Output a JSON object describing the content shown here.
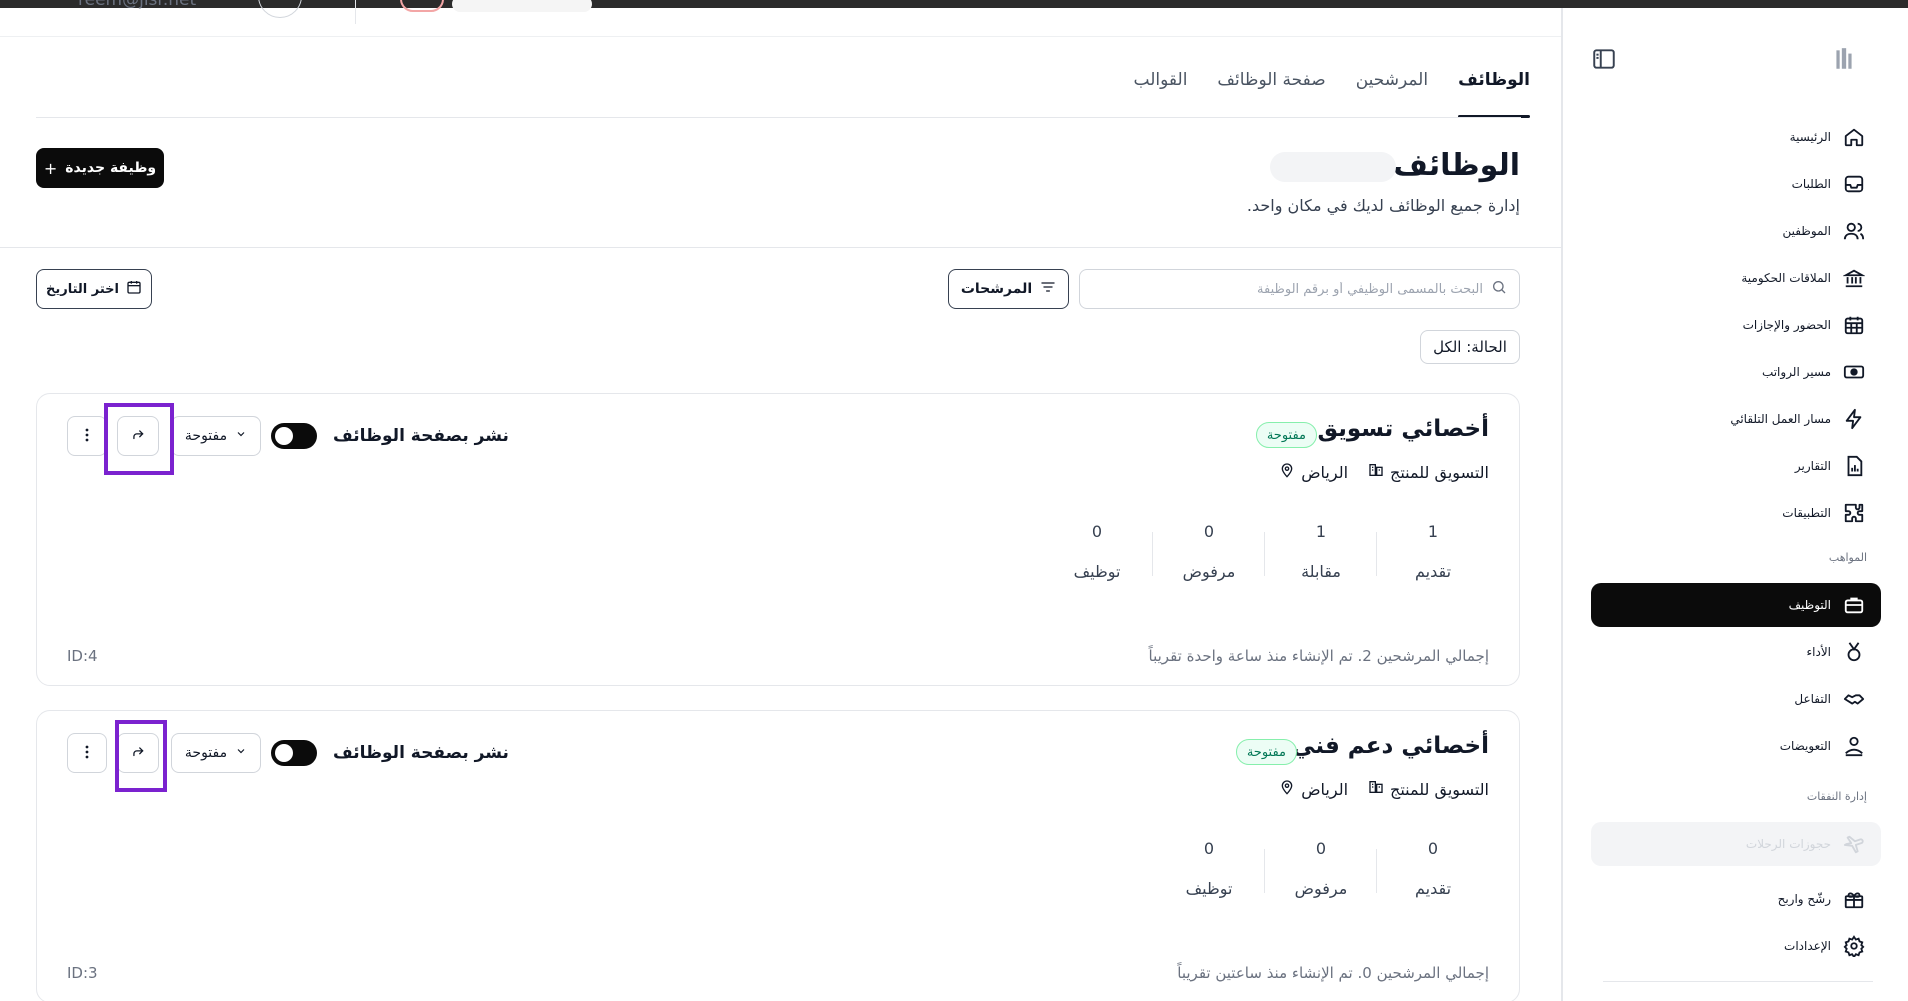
{
  "user": {
    "email": "reem@jisr.net"
  },
  "sidebar": {
    "items": [
      {
        "label": "الرئيسية",
        "icon": "home-icon"
      },
      {
        "label": "الطلبات",
        "icon": "inbox-icon"
      },
      {
        "label": "الموظفين",
        "icon": "users-icon"
      },
      {
        "label": "الملاقات الحكومية",
        "icon": "government-building-icon"
      },
      {
        "label": "الحضور والإجازات",
        "icon": "calendar-icon"
      },
      {
        "label": "مسير الرواتب",
        "icon": "cash-icon"
      },
      {
        "label": "مسار العمل التلقائي",
        "icon": "automation-icon"
      },
      {
        "label": "التقارير",
        "icon": "report-icon"
      },
      {
        "label": "التطبيقات",
        "icon": "puzzle-icon"
      }
    ],
    "section_talent": "المواهب",
    "talent_items": [
      {
        "label": "التوظيف",
        "icon": "briefcase-icon",
        "active": true
      },
      {
        "label": "الأداء",
        "icon": "medal-icon"
      },
      {
        "label": "التفاعل",
        "icon": "handshake-icon"
      },
      {
        "label": "التعويضات",
        "icon": "compensation-icon"
      }
    ],
    "section_spend": "إدارة النفقات",
    "spend_items": [
      {
        "label": "حجوزات الرحلات",
        "icon": "plane-icon",
        "disabled": true
      },
      {
        "label": "رشّح واربح",
        "icon": "gift-icon"
      },
      {
        "label": "الإعدادات",
        "icon": "settings-icon"
      }
    ]
  },
  "tabs": [
    "الوظائف",
    "المرشحين",
    "صفحة الوظائف",
    "القوالب"
  ],
  "active_tab": "الوظائف",
  "page": {
    "title": "الوظائف",
    "subtitle": "إدارة جميع الوظائف لديك في مكان واحد.",
    "new_job_label": "وظيفة جديدة"
  },
  "toolbar": {
    "search_placeholder": "البحث بالمسمى الوظيفي أو برقم الوظيفة",
    "filters_label": "المرشحات",
    "date_label": "اختر التاريخ",
    "status_chip": "الحالة: الكل"
  },
  "jobs": [
    {
      "title": "أخصائي تسويق",
      "badge": "مفتوحة",
      "location": "الرياض",
      "department": "التسويق للمنتج",
      "stats": [
        {
          "label": "تقديم",
          "value": "1"
        },
        {
          "label": "مقابلة",
          "value": "1"
        },
        {
          "label": "مرفوض",
          "value": "0"
        },
        {
          "label": "توظيف",
          "value": "0"
        }
      ],
      "footer": "إجمالي المرشحين 2. تم الإنشاء منذ ساعة واحدة تقريباً",
      "id": "ID:4",
      "publish_label": "نشر بصفحة الوظائف",
      "status_label": "مفتوحة",
      "publish_enabled": false
    },
    {
      "title": "أخصائي دعم فني",
      "badge": "مفتوحة",
      "location": "الرياض",
      "department": "التسويق للمنتج",
      "stats": [
        {
          "label": "تقديم",
          "value": "0"
        },
        {
          "label": "مرفوض",
          "value": "0"
        },
        {
          "label": "توظيف",
          "value": "0"
        }
      ],
      "footer": "إجمالي المرشحين 0. تم الإنشاء منذ ساعتين تقريباً",
      "id": "ID:3",
      "publish_label": "نشر بصفحة الوظائف",
      "status_label": "مفتوحة",
      "publish_enabled": false
    }
  ],
  "colors": {
    "accent": "#0b0b0b",
    "highlight": "#7b22cf",
    "badge_green": "#047857",
    "badge_bg": "#ecfdf5"
  }
}
